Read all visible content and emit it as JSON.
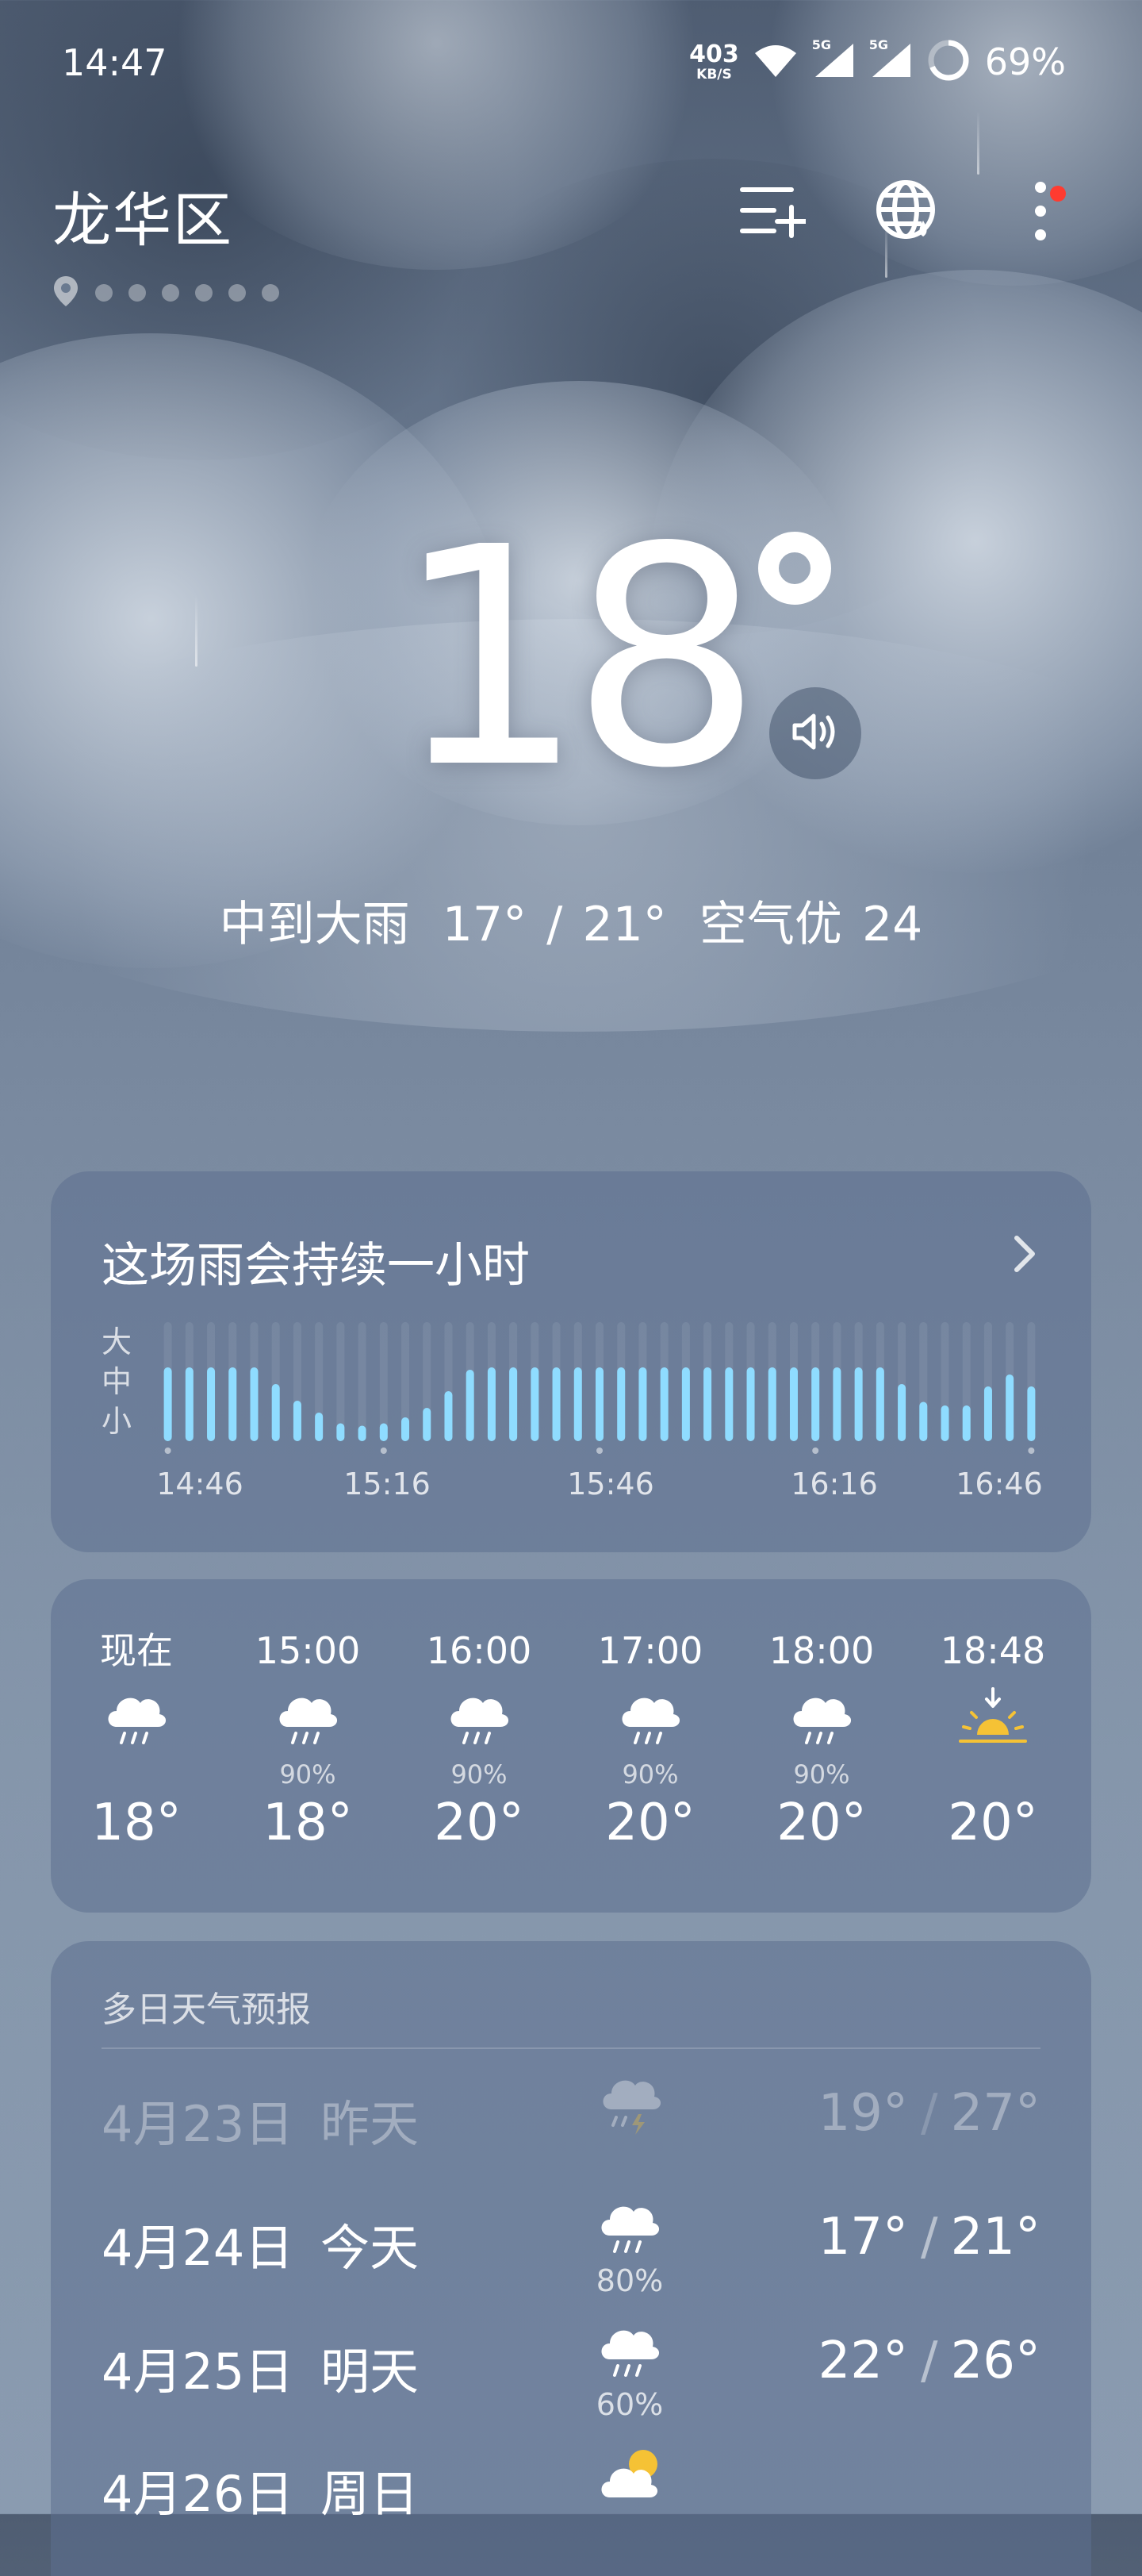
{
  "status_bar": {
    "time": "14:47",
    "net_speed": "403",
    "net_unit": "KB/S",
    "signal1_label": "5G",
    "signal2_label": "5G",
    "battery": "69%"
  },
  "header": {
    "location": "龙华区",
    "page_count": 7,
    "icons": [
      "manage-cities-icon",
      "globe-weather-icon",
      "more-menu-icon"
    ],
    "notification": true
  },
  "current": {
    "temperature": "18",
    "condition": "中到大雨",
    "range": "17° / 21°",
    "aqi": "空气优 24"
  },
  "rain_card": {
    "title": "这场雨会持续一小时",
    "intensity_labels": [
      "大",
      "中",
      "小"
    ],
    "times": [
      "14:46",
      "15:16",
      "15:46",
      "16:16",
      "16:46"
    ]
  },
  "chart_data": {
    "type": "bar",
    "title": "这场雨会持续一小时",
    "ylabel": "",
    "y_levels": [
      "小",
      "中",
      "大"
    ],
    "ylim": [
      0,
      1
    ],
    "x_ticks": [
      "14:46",
      "15:16",
      "15:46",
      "16:16",
      "16:46"
    ],
    "values": [
      0.62,
      0.62,
      0.62,
      0.62,
      0.62,
      0.48,
      0.34,
      0.24,
      0.15,
      0.13,
      0.15,
      0.2,
      0.28,
      0.42,
      0.6,
      0.62,
      0.62,
      0.62,
      0.62,
      0.62,
      0.62,
      0.62,
      0.62,
      0.62,
      0.62,
      0.62,
      0.62,
      0.62,
      0.62,
      0.62,
      0.62,
      0.62,
      0.62,
      0.62,
      0.48,
      0.33,
      0.3,
      0.3,
      0.46,
      0.56,
      0.46
    ],
    "bar_color": "#8fdcff",
    "track_color": "#ffffff"
  },
  "hourly": [
    {
      "time": "现在",
      "icon": "rain-icon",
      "pop": "",
      "temp": "18°"
    },
    {
      "time": "15:00",
      "icon": "rain-icon",
      "pop": "90%",
      "temp": "18°"
    },
    {
      "time": "16:00",
      "icon": "rain-icon",
      "pop": "90%",
      "temp": "20°"
    },
    {
      "time": "17:00",
      "icon": "rain-icon",
      "pop": "90%",
      "temp": "20°"
    },
    {
      "time": "18:00",
      "icon": "rain-icon",
      "pop": "90%",
      "temp": "20°"
    },
    {
      "time": "18:48",
      "icon": "sunset-icon",
      "pop": "",
      "temp": "20°"
    }
  ],
  "daily": {
    "title": "多日天气预报",
    "days": [
      {
        "date": "4月23日",
        "label": "昨天",
        "icon": "thunderstorm-icon",
        "pop": "",
        "low": "19°",
        "high": "27°"
      },
      {
        "date": "4月24日",
        "label": "今天",
        "icon": "rain-icon",
        "pop": "80%",
        "low": "17°",
        "high": "21°"
      },
      {
        "date": "4月25日",
        "label": "明天",
        "icon": "rain-icon",
        "pop": "60%",
        "low": "22°",
        "high": "26°"
      },
      {
        "date": "4月26日",
        "label": "周日",
        "icon": "partly-cloudy-icon",
        "pop": "",
        "low": "",
        "high": ""
      }
    ]
  },
  "colors": {
    "accent_rain": "#8fdcff",
    "sun": "#f5c235",
    "notification": "#ff3b30"
  }
}
